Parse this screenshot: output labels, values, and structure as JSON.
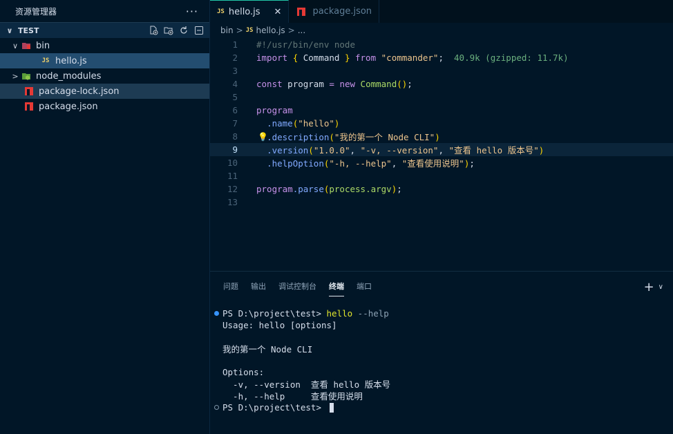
{
  "sidebar": {
    "title": "资源管理器",
    "more": "···",
    "section": "TEST",
    "items": [
      {
        "label": "bin",
        "chevron": "∨",
        "icon": "folder-bin-icon"
      },
      {
        "label": "hello.js",
        "icon": "js-file-icon",
        "badge": "JS"
      },
      {
        "label": "node_modules",
        "chevron": ">",
        "icon": "node-folder-icon"
      },
      {
        "label": "package-lock.json",
        "icon": "npm-icon"
      },
      {
        "label": "package.json",
        "icon": "npm-icon"
      }
    ]
  },
  "tabs": [
    {
      "label": "hello.js",
      "badge": "JS",
      "close": "✕"
    },
    {
      "label": "package.json"
    }
  ],
  "breadcrumb": {
    "folder": "bin",
    "sep": ">",
    "badge": "JS",
    "file": "hello.js",
    "more": "..."
  },
  "code": {
    "l1": "#!/usr/bin/env node",
    "l2_import": "import",
    "l2_open": "{",
    "l2_cmd": " Command ",
    "l2_close": "}",
    "l2_from": " from ",
    "l2_str": "\"commander\"",
    "l2_semi": ";",
    "l2_size": "40.9k (gzipped: 11.7k)",
    "l4_const": "const",
    "l4_prog": " program ",
    "l4_eq": "= ",
    "l4_new": "new",
    "l4_cls": " Command",
    "l4_paren": "()",
    "l4_semi": ";",
    "l6": "program",
    "l7_m": ".name",
    "l7_s": "\"hello\"",
    "l8_m": ".description",
    "l8_s": "\"我的第一个 Node CLI\"",
    "l9_m": ".version",
    "l9_s1": "\"1.0.0\"",
    "l9_s2": "\"-v, --version\"",
    "l9_s3": "\"查看 hello 版本号\"",
    "l10_m": ".helpOption",
    "l10_s1": "\"-h, --help\"",
    "l10_s2": "\"查看使用说明\"",
    "l12_p": "program",
    "l12_m": ".parse",
    "l12_a": "process",
    "l12_b": ".argv",
    "line_numbers": [
      "1",
      "2",
      "3",
      "4",
      "5",
      "6",
      "7",
      "8",
      "9",
      "10",
      "11",
      "12",
      "13"
    ]
  },
  "panel": {
    "tabs": [
      "问题",
      "输出",
      "调试控制台",
      "终端",
      "端口"
    ],
    "add": "+",
    "dropdown": "∨",
    "terminal": {
      "prompt1": "PS D:\\project\\test> ",
      "cmd": "hello",
      "arg": " --help",
      "usage": "Usage: hello [options]",
      "desc": "我的第一个 Node CLI",
      "options": "Options:",
      "opt1": "  -v, --version  查看 hello 版本号",
      "opt2": "  -h, --help     查看使用说明",
      "prompt2": "PS D:\\project\\test> "
    }
  }
}
